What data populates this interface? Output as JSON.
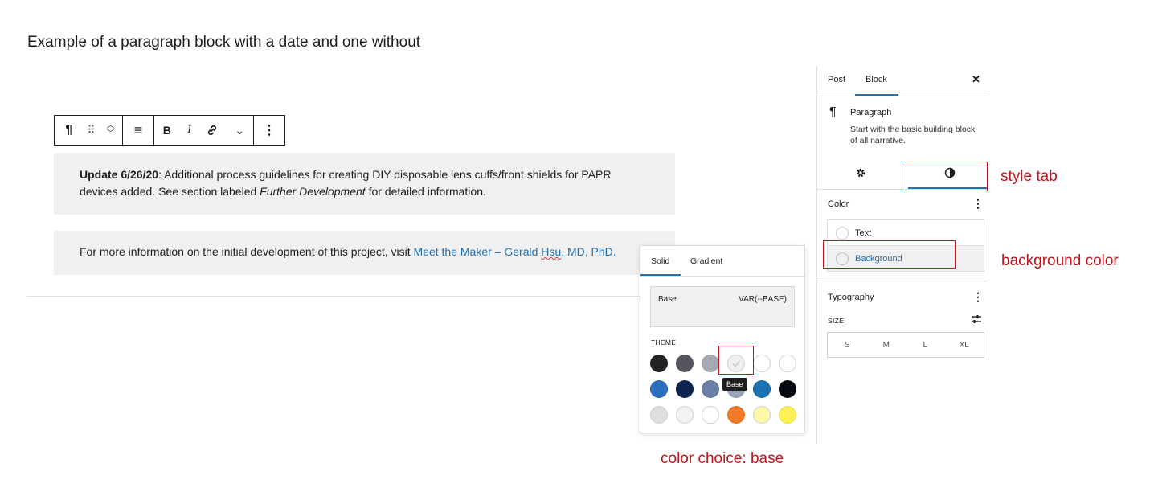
{
  "page": {
    "title": "Example of a paragraph block with a date and one without"
  },
  "toolbar": {
    "paragraph_icon": "¶",
    "drag_icon": "⠿",
    "move_up_icon": "︿",
    "move_down_icon": "﹀",
    "align_icon": "≡",
    "bold_label": "B",
    "italic_label": "I",
    "link_icon": "link-icon",
    "more_icon": "⌄",
    "options_icon": "⋮"
  },
  "blocks": {
    "para1": {
      "bold_prefix": "Update 6/26/20",
      "text_a": ": Additional process guidelines for creating DIY disposable lens cuffs/front shields for PAPR devices added. See section labeled ",
      "italic": "Further Development",
      "text_b": " for detailed information."
    },
    "para2": {
      "text": "For more information on the initial development of this project, visit ",
      "link_a": "Meet the Maker – Gerald ",
      "link_b": "Hsu",
      "link_c": ", MD, PhD."
    }
  },
  "sidebar": {
    "tabs": [
      "Post",
      "Block"
    ],
    "close_icon": "✕",
    "block_icon": "¶",
    "block_name": "Paragraph",
    "block_desc_line1": "Start with the basic building block",
    "block_desc_line2": "of all narrative.",
    "settings_icon": "gear-icon",
    "styles_icon": "half-circle-icon",
    "color_heading": "Color",
    "more_icon": "⋮",
    "color_items": [
      "Text",
      "Background"
    ],
    "typography_heading": "Typography",
    "size_label": "SIZE",
    "size_options": [
      "S",
      "M",
      "L",
      "XL"
    ]
  },
  "popover": {
    "tabs": [
      "Solid",
      "Gradient"
    ],
    "preview_name": "Base",
    "preview_value": "VAR(--BASE)",
    "theme_label": "THEME",
    "tooltip": "Base",
    "swatches": [
      [
        "#222222",
        "#555560",
        "#a9a9b3",
        "#f0f0f0",
        "#ffffff",
        "#ffffff"
      ],
      [
        "#2c6dbd",
        "#0d2450",
        "#6a7fa8",
        "#9ba6bc",
        "#1c71b0",
        "#050a10"
      ],
      [
        "#dedede",
        "#f2f2f2",
        "#ffffff",
        "#f07a27",
        "#fef7a8",
        "#fdef54"
      ]
    ]
  },
  "annotations": {
    "style_tab": "style tab",
    "background_color": "background color",
    "color_choice": "color choice: base"
  },
  "colors": {
    "accent": "#2271b1",
    "annotation_red": "#c0151d"
  }
}
